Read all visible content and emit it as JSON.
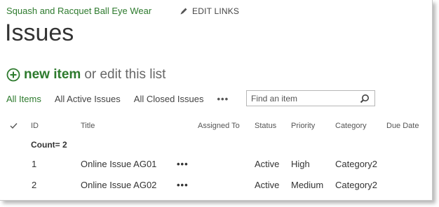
{
  "header": {
    "site_title": "Squash and Racquet Ball Eye Wear",
    "edit_links": "EDIT LINKS",
    "page_title": "Issues"
  },
  "actions": {
    "new_item": "new item",
    "or_edit": "or edit this list"
  },
  "views": {
    "all_items": "All Items",
    "all_active": "All Active Issues",
    "all_closed": "All Closed Issues",
    "more": "•••"
  },
  "search": {
    "placeholder": "Find an item"
  },
  "table": {
    "columns": [
      "ID",
      "Title",
      "Assigned To",
      "Status",
      "Priority",
      "Category",
      "Due Date"
    ],
    "group_label": "Count= 2",
    "rows": [
      {
        "id": "1",
        "title": "Online Issue AG01",
        "menu": "•••",
        "assigned_to": "",
        "status": "Active",
        "priority": "High",
        "category": "Category2",
        "due_date": ""
      },
      {
        "id": "2",
        "title": "Online Issue AG02",
        "menu": "•••",
        "assigned_to": "",
        "status": "Active",
        "priority": "Medium",
        "category": "Category2",
        "due_date": ""
      }
    ]
  },
  "colors": {
    "accent": "#2d7a2d",
    "text": "#444444"
  }
}
